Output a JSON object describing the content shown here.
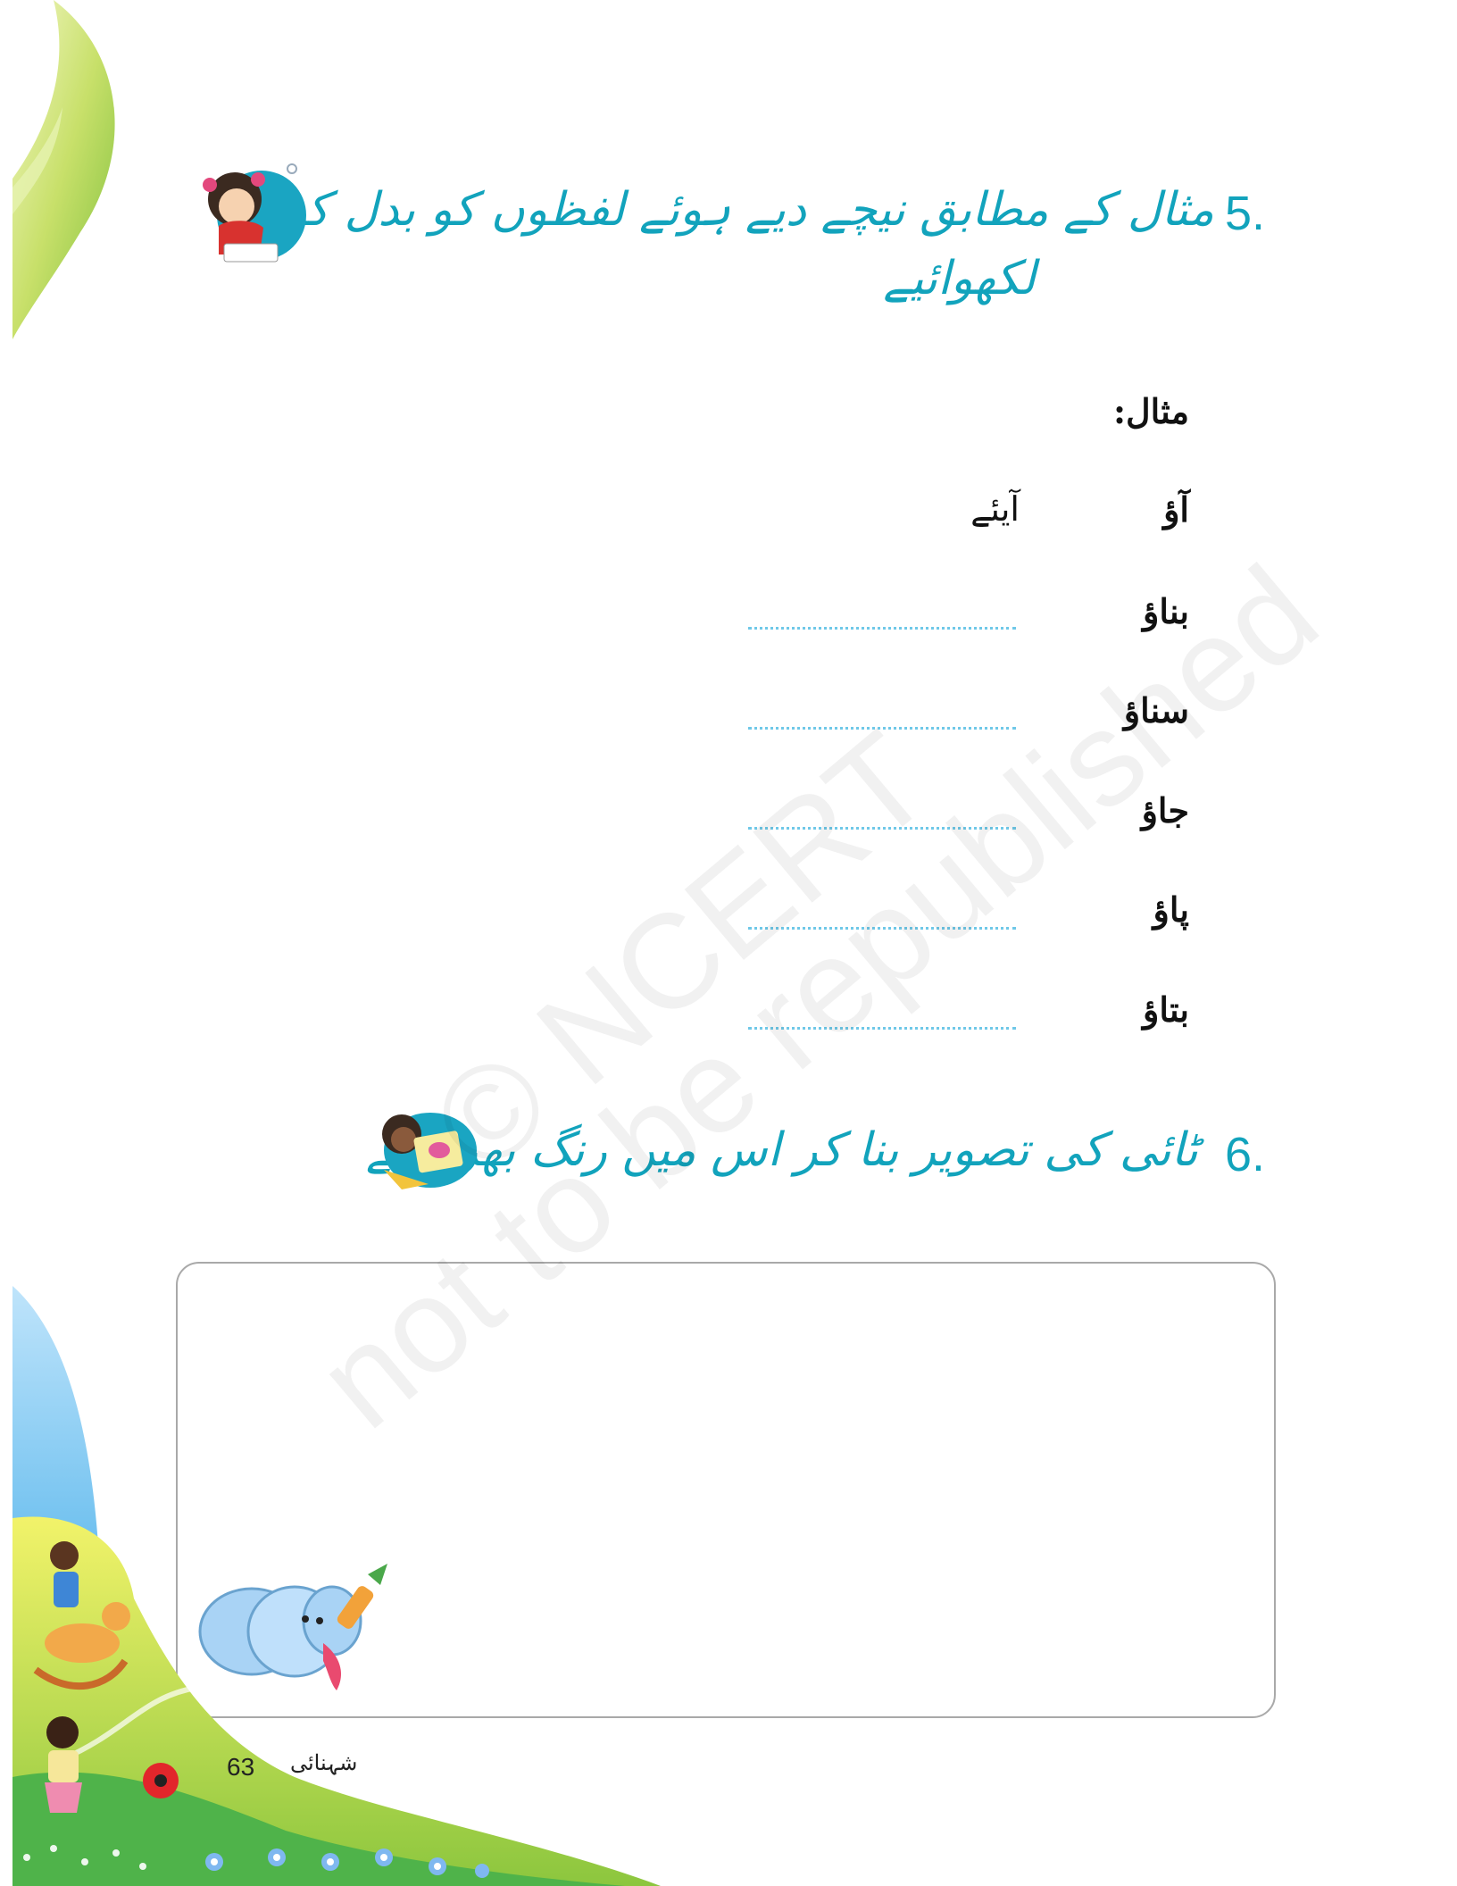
{
  "question5": {
    "number": "5.",
    "instruction_line1": "مثال کے مطابق نیچے دیے ہوئے لفظوں کو بدل کر",
    "instruction_line2": "لکھوائیے"
  },
  "example": {
    "label": "مثال:",
    "given": "آؤ",
    "answer": "آیئے"
  },
  "exercise_words": [
    "بناؤ",
    "سناؤ",
    "جاؤ",
    "پاؤ",
    "بتاؤ"
  ],
  "question6": {
    "number": "6.",
    "instruction": "ٹائی کی تصویر بنا کر اس میں رنگ بھروائیے"
  },
  "watermark": {
    "line1": "© NCERT",
    "line2": "not to be republished"
  },
  "footer": {
    "page_number": "63",
    "book_title": "شہنائی"
  },
  "colors": {
    "heading_accent": "#12a3bc",
    "dotted_line": "#6fc8e8",
    "box_border": "#a9a9a9"
  }
}
